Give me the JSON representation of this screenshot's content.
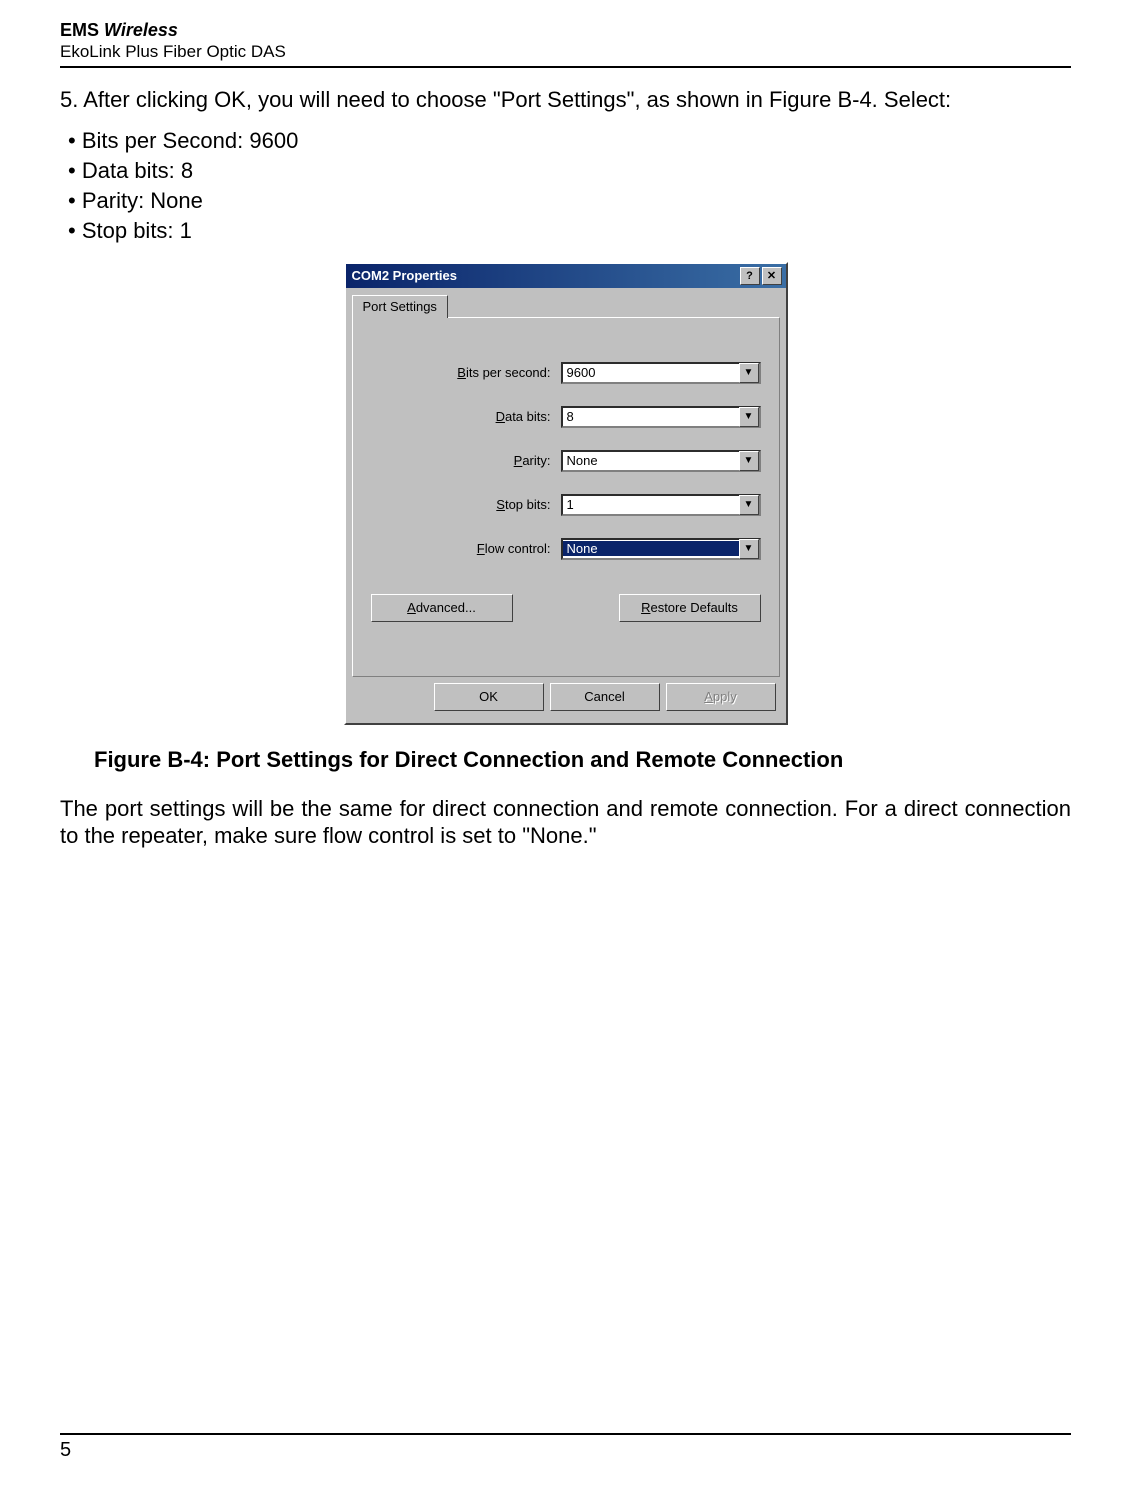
{
  "header": {
    "brand": "EMS",
    "brand_italic": "Wireless",
    "product": "EkoLink Plus Fiber Optic DAS"
  },
  "step": {
    "text": "5.  After clicking OK, you will need to choose \"Port Settings\", as shown in Figure B-4. Select:"
  },
  "settings_list": [
    "Bits per Second: 9600",
    "Data bits: 8",
    "Parity: None",
    "Stop bits: 1"
  ],
  "dialog": {
    "title": "COM2 Properties",
    "help_btn": "?",
    "close_btn": "✕",
    "tab_label": "Port Settings",
    "fields": {
      "bits_per_second": {
        "label_pre": "B",
        "label_rest": "its per second:",
        "value": "9600"
      },
      "data_bits": {
        "label_pre": "D",
        "label_rest": "ata bits:",
        "value": "8"
      },
      "parity": {
        "label_pre": "P",
        "label_rest": "arity:",
        "value": "None"
      },
      "stop_bits": {
        "label_pre": "S",
        "label_rest": "top bits:",
        "value": "1"
      },
      "flow_control": {
        "label_pre": "F",
        "label_rest": "low control:",
        "value": "None"
      }
    },
    "advanced_pre": "A",
    "advanced_rest": "dvanced...",
    "restore_pre": "R",
    "restore_rest": "estore Defaults",
    "ok": "OK",
    "cancel": "Cancel",
    "apply_pre": "A",
    "apply_rest": "pply"
  },
  "figure_caption": "Figure B-4:   Port Settings for Direct Connection and Remote Connection",
  "body_text": "The port settings will be the same for direct connection and remote connection. For a direct connection to the repeater, make sure flow control is set to \"None.\"",
  "page_number": "5"
}
